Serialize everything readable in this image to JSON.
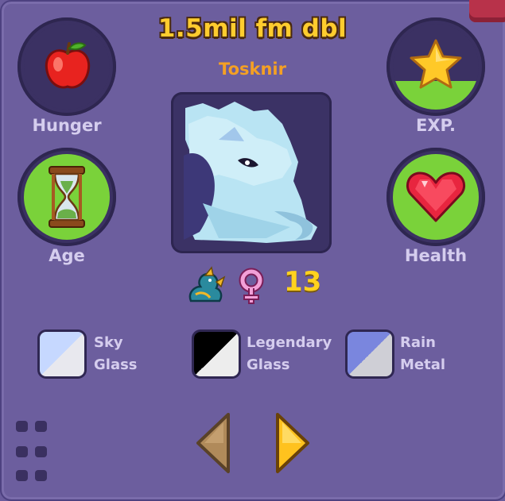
{
  "title": "1.5mil fm dbl",
  "dragon_name": "Tosknir",
  "stats": {
    "hunger": {
      "label": "Hunger",
      "icon": "apple-icon"
    },
    "exp": {
      "label": "EXP.",
      "icon": "star-icon",
      "progress": 0.33
    },
    "age": {
      "label": "Age",
      "icon": "hourglass-icon"
    },
    "health": {
      "label": "Health",
      "icon": "heart-icon"
    }
  },
  "info": {
    "dragon_icon": "dragon-icon",
    "gender_icon": "female-icon",
    "count": "13"
  },
  "genes": [
    {
      "line1": "Sky",
      "line2": "Glass",
      "color_top": "#c6d8ff",
      "color_bottom": "#e8e8ee"
    },
    {
      "line1": "Legendary",
      "line2": "Glass",
      "color_top": "#000000",
      "color_bottom": "#ededed"
    },
    {
      "line1": "Rain",
      "line2": "Metal",
      "color_top": "#7a86de",
      "color_bottom": "#cfcfd6"
    }
  ],
  "colors": {
    "panel": "#6c5e9e",
    "title": "#ffcc2e",
    "name": "#f4a024",
    "green": "#7ad23a",
    "label": "#d5cdee"
  }
}
